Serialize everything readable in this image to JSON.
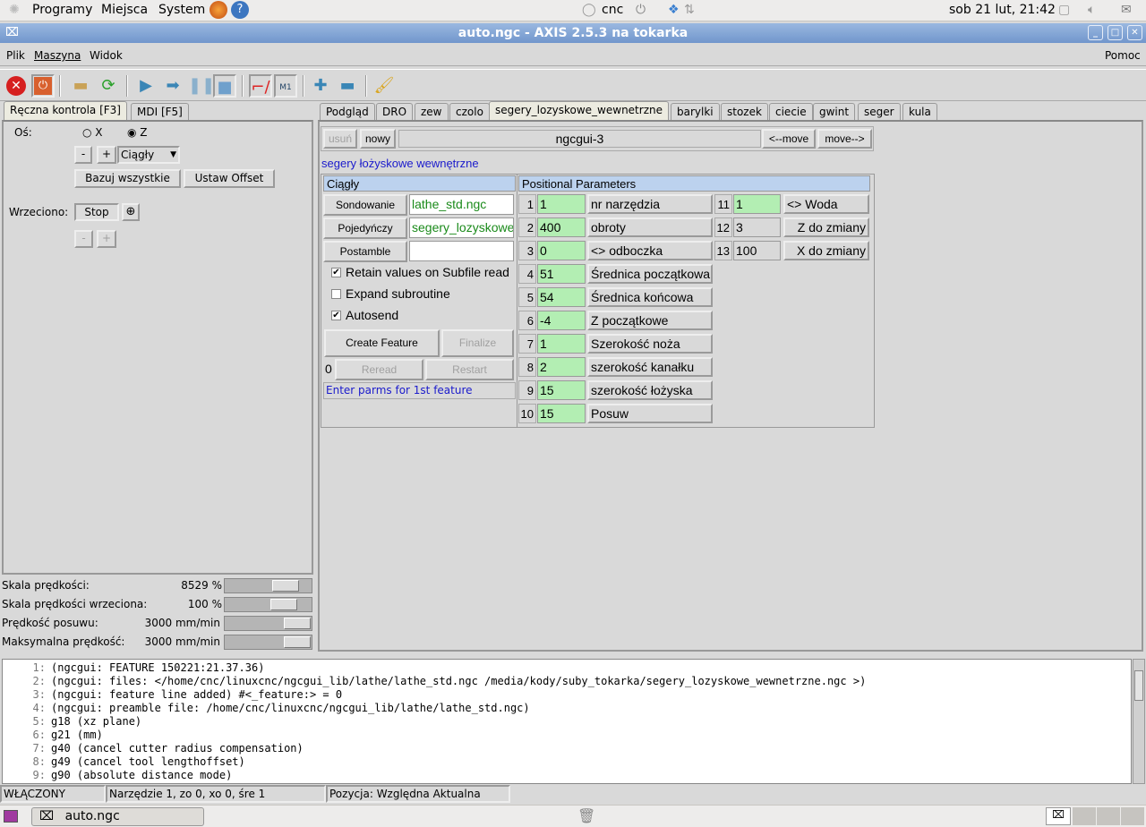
{
  "top_panel": {
    "menus": [
      "Programy",
      "Miejsca",
      "System"
    ],
    "user": "cnc",
    "clock": "sob 21 lut, 21:42"
  },
  "window": {
    "title": "auto.ngc - AXIS 2.5.3 na tokarka"
  },
  "menubar": {
    "items": [
      "Plik",
      "Maszyna",
      "Widok"
    ],
    "help": "Pomoc"
  },
  "toolbar": {
    "icons": [
      "estop-icon",
      "power-icon",
      "open-file-icon",
      "reload-icon",
      "run-icon",
      "step-icon",
      "pause-icon",
      "stop-icon",
      "block-delete-icon",
      "optional-stop-icon",
      "zoom-in-icon",
      "zoom-out-icon",
      "clear-plot-icon"
    ],
    "m1_label": "M1"
  },
  "left": {
    "tabs": [
      "Ręczna kontrola [F3]",
      "MDI [F5]"
    ],
    "axis_label": "Oś:",
    "axis_x": "X",
    "axis_z": "Z",
    "axis_selected": "Z",
    "minus": "-",
    "plus": "+",
    "jog_mode": "Ciągły",
    "home_all": "Bazuj wszystkie",
    "set_offset": "Ustaw Offset",
    "spindle_label": "Wrzeciono:",
    "spindle_stop": "Stop"
  },
  "sliders": [
    {
      "label": "Skala prędkości:",
      "value": "8529 %",
      "level": 0.8
    },
    {
      "label": "Skala prędkości wrzeciona:",
      "value": "100 %",
      "level": 0.78
    },
    {
      "label": "Prędkość posuwu:",
      "value": "3000 mm/min",
      "level": 1.0
    },
    {
      "label": "Maksymalna prędkość:",
      "value": "3000 mm/min",
      "level": 1.0
    }
  ],
  "right": {
    "tabs": [
      "Podgląd",
      "DRO",
      "zew",
      "czolo",
      "segery_lozyskowe_wewnetrzne",
      "barylki",
      "stozek",
      "ciecie",
      "gwint",
      "seger",
      "kula"
    ],
    "active_tab": "segery_lozyskowe_wewnetrzne",
    "remove": "usuń",
    "new": "nowy",
    "page_name": "ngcgui-3",
    "move_left": "<--move",
    "move_right": "move-->",
    "subtitle": "segery łożyskowe wewnętrzne",
    "ctrl_header": "Ciągły",
    "preamble_btn": "Sondowanie",
    "preamble_file": "lathe_std.ngc",
    "subfile_btn": "Pojedyńczy",
    "subfile_file": "segery_lozyskowe_wewnetrzne.ngc",
    "postamble_btn": "Postamble",
    "postamble_file": "",
    "retain": "Retain values on Subfile read",
    "retain_checked": true,
    "expand": "Expand subroutine",
    "expand_checked": false,
    "autosend": "Autosend",
    "autosend_checked": true,
    "create": "Create Feature",
    "finalize": "Finalize",
    "count": "0",
    "reread": "Reread",
    "restart": "Restart",
    "status": "Enter parms for 1st feature",
    "params_header": "Positional Parameters",
    "params": [
      {
        "n": "1",
        "value": "1",
        "label": "nr narzędzia"
      },
      {
        "n": "2",
        "value": "400",
        "label": "obroty"
      },
      {
        "n": "3",
        "value": "0",
        "label": "<> odboczka"
      },
      {
        "n": "4",
        "value": "51",
        "label": "Średnica początkowa"
      },
      {
        "n": "5",
        "value": "54",
        "label": "Średnica końcowa"
      },
      {
        "n": "6",
        "value": "-4",
        "label": "Z początkowe"
      },
      {
        "n": "7",
        "value": "1",
        "label": "Szerokość noża"
      },
      {
        "n": "8",
        "value": "2",
        "label": "szerokość kanałku"
      },
      {
        "n": "9",
        "value": "15",
        "label": "szerokość łożyska"
      },
      {
        "n": "10",
        "value": "15",
        "label": "Posuw"
      },
      {
        "n": "11",
        "value": "1",
        "label": "<> Woda"
      },
      {
        "n": "12",
        "value": "3",
        "label": "Z  do zmiany"
      },
      {
        "n": "13",
        "value": "100",
        "label": "X  do zmiany"
      }
    ]
  },
  "gcode": [
    {
      "n": "1:",
      "t": "(ngcgui: FEATURE 150221:21.37.36)"
    },
    {
      "n": "2:",
      "t": "(ngcgui: files: </home/cnc/linuxcnc/ngcgui_lib/lathe/lathe_std.ngc /media/kody/suby_tokarka/segery_lozyskowe_wewnetrzne.ngc >)"
    },
    {
      "n": "3:",
      "t": "(ngcgui: feature line added) #<_feature:> = 0"
    },
    {
      "n": "4:",
      "t": "(ngcgui: preamble file: /home/cnc/linuxcnc/ngcgui_lib/lathe/lathe_std.ngc)"
    },
    {
      "n": "5:",
      "t": "g18 (xz plane)"
    },
    {
      "n": "6:",
      "t": "g21 (mm)"
    },
    {
      "n": "7:",
      "t": "g40 (cancel cutter radius compensation)"
    },
    {
      "n": "8:",
      "t": "g49 (cancel tool lengthoffset)"
    },
    {
      "n": "9:",
      "t": "g90 (absolute distance mode)"
    }
  ],
  "statusbar": {
    "state": "WŁĄCZONY",
    "tool": "Narzędzie 1, zo 0, xo 0, śre 1",
    "position": "Pozycja: Względna Aktualna"
  },
  "taskbar": {
    "task": "auto.ngc"
  },
  "colors": {
    "param_entry": "#b3eeb3",
    "header": "#bcd2ee",
    "title_bar": "#7f9fd2",
    "subtitle": "#1a1acc",
    "file_text": "#1a8a1a"
  }
}
